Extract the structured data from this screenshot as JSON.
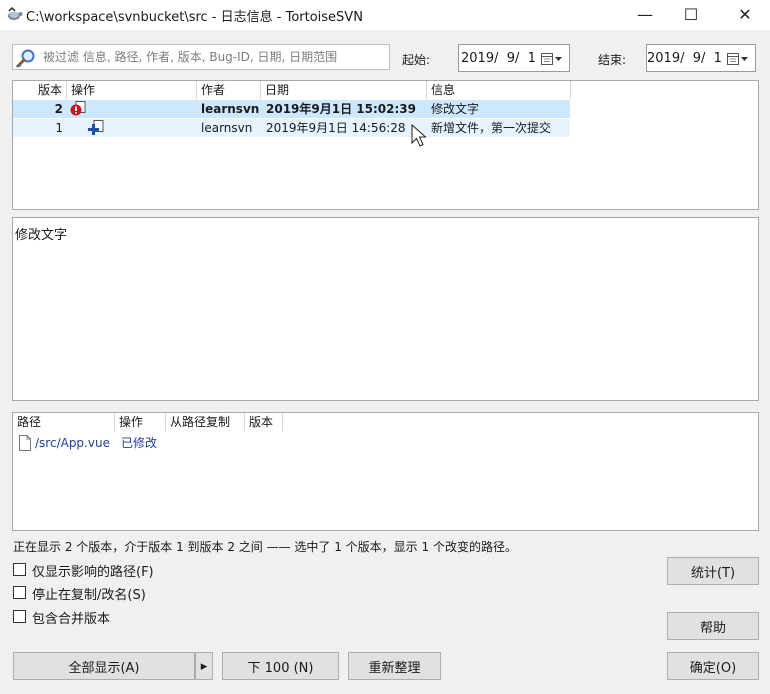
{
  "window": {
    "title": "C:\\workspace\\svnbucket\\src - 日志信息 - TortoiseSVN",
    "minimize_glyph": "—",
    "maximize_glyph": "☐",
    "close_glyph": "✕"
  },
  "filter": {
    "placeholder": "被过滤 信息, 路径, 作者, 版本, Bug-ID, 日期, 日期范围",
    "from_label": "起始:",
    "from_date": "2019/  9/  1",
    "to_label": "结束:",
    "to_date": "2019/  9/  1"
  },
  "revisions": {
    "columns": [
      "版本",
      "操作",
      "作者",
      "日期",
      "信息"
    ],
    "rows": [
      {
        "revision": "2",
        "action_icon": "modified-icon",
        "author": "learnsvn",
        "date": "2019年9月1日 15:02:39",
        "message": "修改文字"
      },
      {
        "revision": "1",
        "action_icon": "added-icon",
        "author": "learnsvn",
        "date": "2019年9月1日 14:56:28",
        "message": "新增文件，第一次提交"
      }
    ],
    "selected_row_color": "#cce8ff",
    "hover_row_color": "#e5f3ff"
  },
  "message_pane": {
    "text": "修改文字"
  },
  "paths": {
    "columns": [
      "路径",
      "操作",
      "从路径复制",
      "版本"
    ],
    "rows": [
      {
        "path": "/src/App.vue",
        "action": "已修改",
        "copy_from": "",
        "revision": ""
      }
    ],
    "link_color": "#1f3fa0"
  },
  "status_text": "正在显示 2 个版本，介于版本 1 到版本 2 之间 —— 选中了 1 个版本，显示 1 个改变的路径。",
  "options": {
    "affected_paths": "仅显示影响的路径(F)",
    "stop_on_copy": "停止在复制/改名(S)",
    "include_merged": "包含合并版本"
  },
  "buttons": {
    "statistics": "统计(T)",
    "help": "帮助",
    "show_all": "全部显示(A)",
    "show_all_arrow": "▸",
    "next_100": "下 100 (N)",
    "refresh": "重新整理",
    "ok": "确定(O)"
  }
}
